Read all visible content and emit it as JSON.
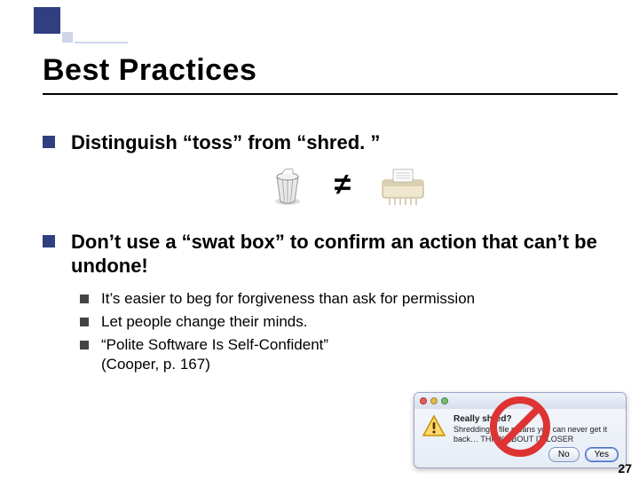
{
  "title": "Best Practices",
  "bullets": [
    {
      "text": "Distinguish “toss” from “shred. ”"
    },
    {
      "text": "Don’t use a “swat box” to confirm an action that can’t be undone!"
    }
  ],
  "neq_symbol": "≠",
  "sub_bullets": [
    "It’s easier to beg for forgiveness than ask for permission",
    "Let people change their minds.",
    "“Polite Software Is Self-Confident”\n(Cooper, p. 167)"
  ],
  "dialog": {
    "title": "Really shred?",
    "body": "Shredding a file means you can never get it back… THINK ABOUT IT, LOSER",
    "buttons": {
      "no": "No",
      "yes": "Yes"
    }
  },
  "page_number": "27"
}
